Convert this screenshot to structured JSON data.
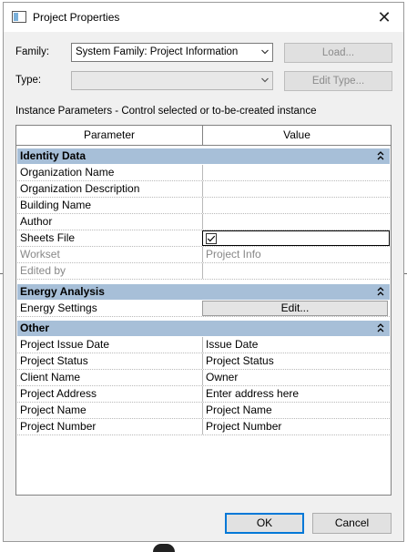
{
  "dialog": {
    "title": "Project Properties",
    "close_label": "✕"
  },
  "family": {
    "label": "Family:",
    "value": "System Family: Project Information",
    "load_button": "Load..."
  },
  "type": {
    "label": "Type:",
    "value": "",
    "edit_type_button": "Edit Type..."
  },
  "instance_description": "Instance Parameters - Control selected or to-be-created instance",
  "grid": {
    "headers": [
      "Parameter",
      "Value"
    ],
    "groups": [
      {
        "name": "Identity Data",
        "rows": [
          {
            "param": "Organization Name",
            "value": ""
          },
          {
            "param": "Organization Description",
            "value": ""
          },
          {
            "param": "Building Name",
            "value": ""
          },
          {
            "param": "Author",
            "value": ""
          },
          {
            "param": "Sheets File",
            "value": "",
            "checked": true
          },
          {
            "param": "Workset",
            "value": "Project Info",
            "readonly": true
          },
          {
            "param": "Edited by",
            "value": "",
            "readonly": true
          }
        ]
      },
      {
        "name": "Energy Analysis",
        "rows": [
          {
            "param": "Energy Settings",
            "value": "Edit..."
          }
        ]
      },
      {
        "name": "Other",
        "rows": [
          {
            "param": "Project Issue Date",
            "value": "Issue Date"
          },
          {
            "param": "Project Status",
            "value": "Project Status"
          },
          {
            "param": "Client Name",
            "value": "Owner"
          },
          {
            "param": "Project Address",
            "value": "Enter address here"
          },
          {
            "param": "Project Name",
            "value": "Project Name"
          },
          {
            "param": "Project Number",
            "value": "Project Number"
          }
        ]
      }
    ]
  },
  "buttons": {
    "ok": "OK",
    "cancel": "Cancel"
  },
  "colors": {
    "group_header": "#a7bfd8",
    "ok_focus": "#0078d7"
  }
}
